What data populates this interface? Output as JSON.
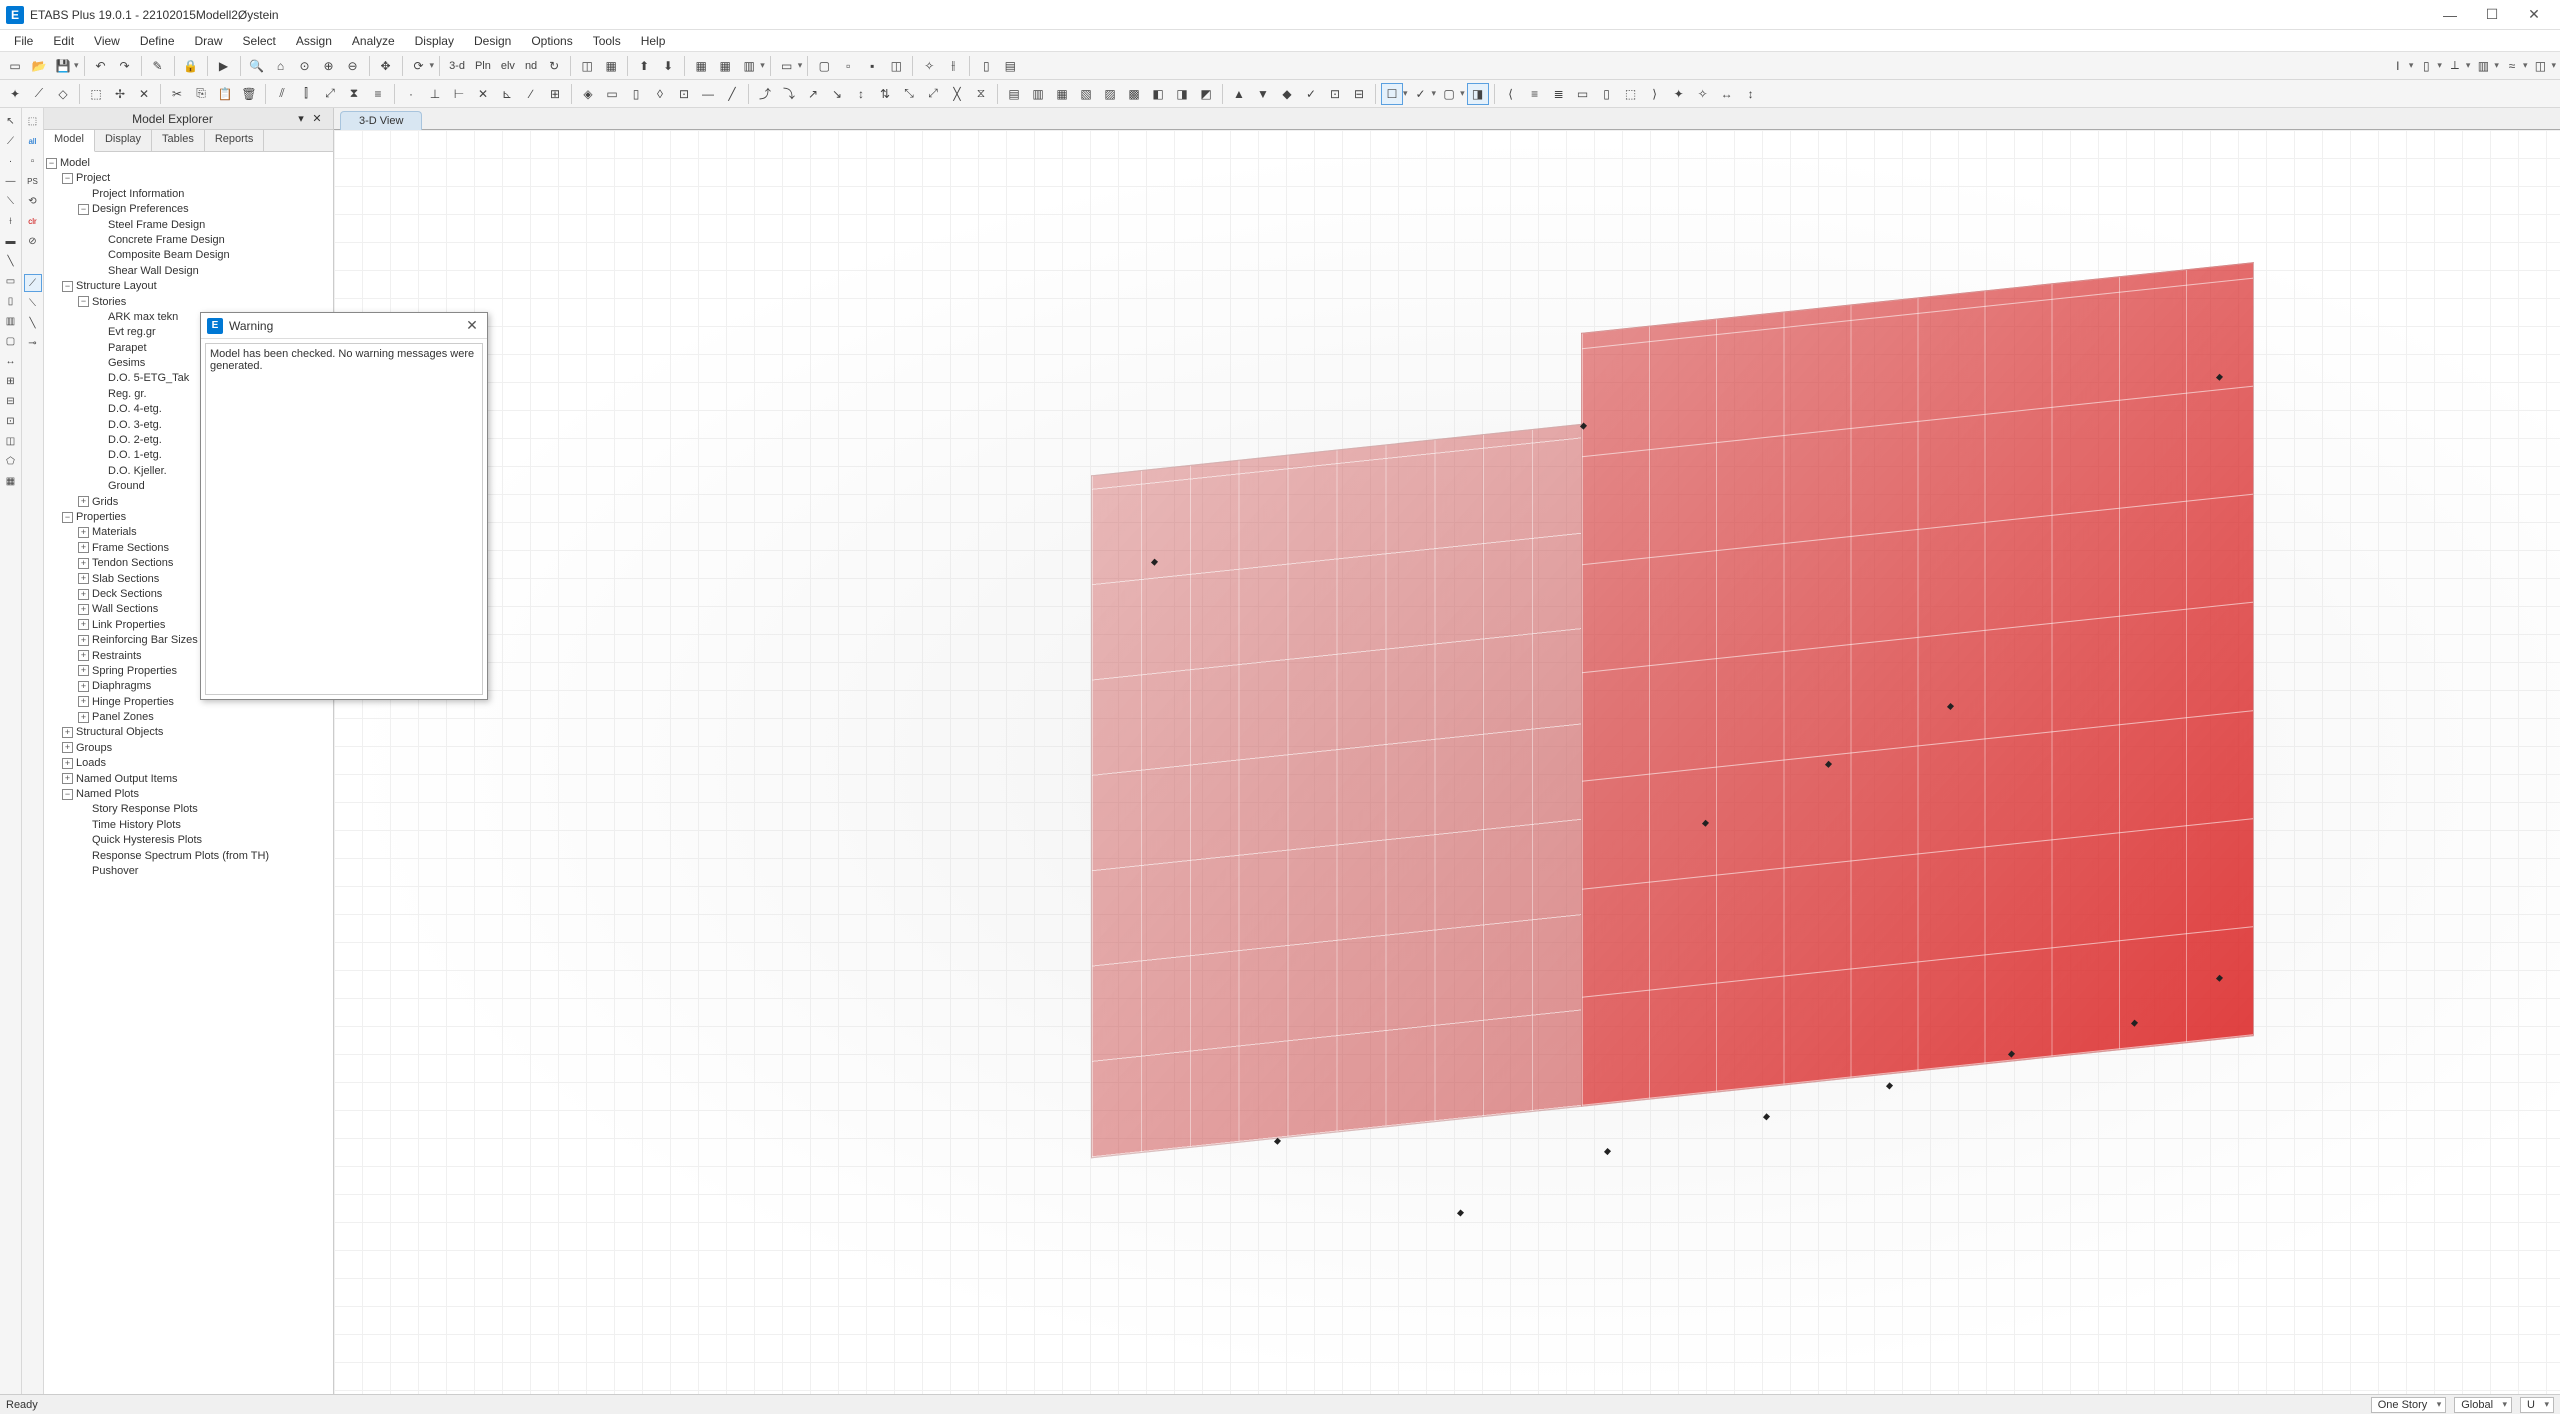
{
  "app": {
    "title": "ETABS Plus 19.0.1 - 22102015Modell2Øystein",
    "icon_letter": "E"
  },
  "menu": [
    "File",
    "Edit",
    "View",
    "Define",
    "Draw",
    "Select",
    "Assign",
    "Analyze",
    "Display",
    "Design",
    "Options",
    "Tools",
    "Help"
  ],
  "toolbar1_labels": {
    "t3d": "3-d",
    "pln": "Pln",
    "elv": "elv",
    "nd": "nd"
  },
  "explorer": {
    "title": "Model Explorer",
    "tabs": [
      "Model",
      "Display",
      "Tables",
      "Reports"
    ],
    "tree": {
      "root": "Model",
      "project": "Project",
      "project_info": "Project Information",
      "design_prefs": "Design Preferences",
      "design_children": [
        "Steel Frame Design",
        "Concrete Frame Design",
        "Composite Beam Design",
        "Shear Wall Design"
      ],
      "structure_layout": "Structure Layout",
      "stories": "Stories",
      "stories_children": [
        "ARK max tekn",
        "Evt reg.gr",
        "Parapet",
        "Gesims",
        "D.O. 5-ETG_Tak",
        "Reg. gr.",
        "D.O. 4-etg.",
        "D.O. 3-etg.",
        "D.O. 2-etg.",
        "D.O. 1-etg.",
        "D.O. Kjeller.",
        "Ground"
      ],
      "grids": "Grids",
      "properties": "Properties",
      "properties_children": [
        "Materials",
        "Frame Sections",
        "Tendon Sections",
        "Slab Sections",
        "Deck Sections",
        "Wall Sections",
        "Link Properties",
        "Reinforcing Bar Sizes",
        "Restraints",
        "Spring Properties",
        "Diaphragms",
        "Hinge Properties",
        "Panel Zones"
      ],
      "structural_objects": "Structural Objects",
      "groups": "Groups",
      "loads": "Loads",
      "named_output": "Named Output Items",
      "named_plots": "Named Plots",
      "named_plots_children": [
        "Story Response Plots",
        "Time History Plots",
        "Quick Hysteresis Plots",
        "Response Spectrum Plots (from TH)",
        "Pushover"
      ]
    }
  },
  "viewport": {
    "tab": "3-D View"
  },
  "dialog": {
    "title": "Warning",
    "message": "Model has been checked.   No warning messages were generated."
  },
  "status": {
    "ready": "Ready",
    "story_dd": "One Story",
    "coord_dd": "Global",
    "unit_dd": "U"
  }
}
